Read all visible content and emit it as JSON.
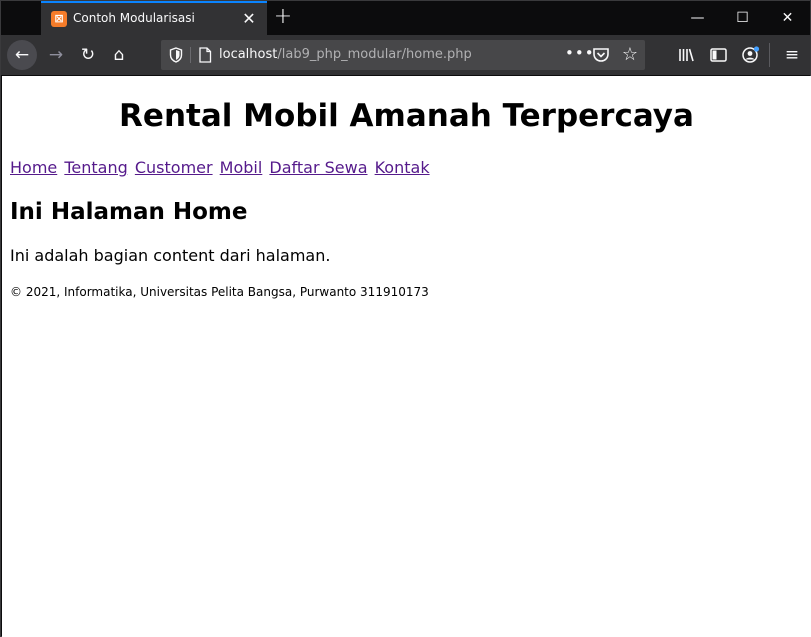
{
  "browser": {
    "tab": {
      "title": "Contoh Modularisasi",
      "favicon": "xampp-icon",
      "close": "✕"
    },
    "new_tab": "+",
    "window_controls": {
      "minimize": "—",
      "maximize": "☐",
      "close": "✕"
    },
    "toolbar": {
      "back": "←",
      "forward": "→",
      "reload": "↻",
      "home": "⌂",
      "more": "•••",
      "star": "☆",
      "library": "|||\\",
      "sidebar": "▯",
      "account": "◉",
      "menu": "≡"
    },
    "url": {
      "host": "localhost",
      "path": "/lab9_php_modular/home.php"
    }
  },
  "page": {
    "site_title": "Rental Mobil Amanah Terpercaya",
    "nav": [
      {
        "label": "Home"
      },
      {
        "label": "Tentang"
      },
      {
        "label": "Customer"
      },
      {
        "label": "Mobil"
      },
      {
        "label": "Daftar Sewa"
      },
      {
        "label": "Kontak"
      }
    ],
    "heading": "Ini Halaman Home",
    "content": "Ini adalah bagian content dari halaman.",
    "footer": "© 2021, Informatika, Universitas Pelita Bangsa, Purwanto 311910173"
  },
  "colors": {
    "link_visited": "#551a8b",
    "tab_accent": "#0a84ff",
    "chrome_dark": "#0c0c0d",
    "toolbar": "#323234"
  }
}
